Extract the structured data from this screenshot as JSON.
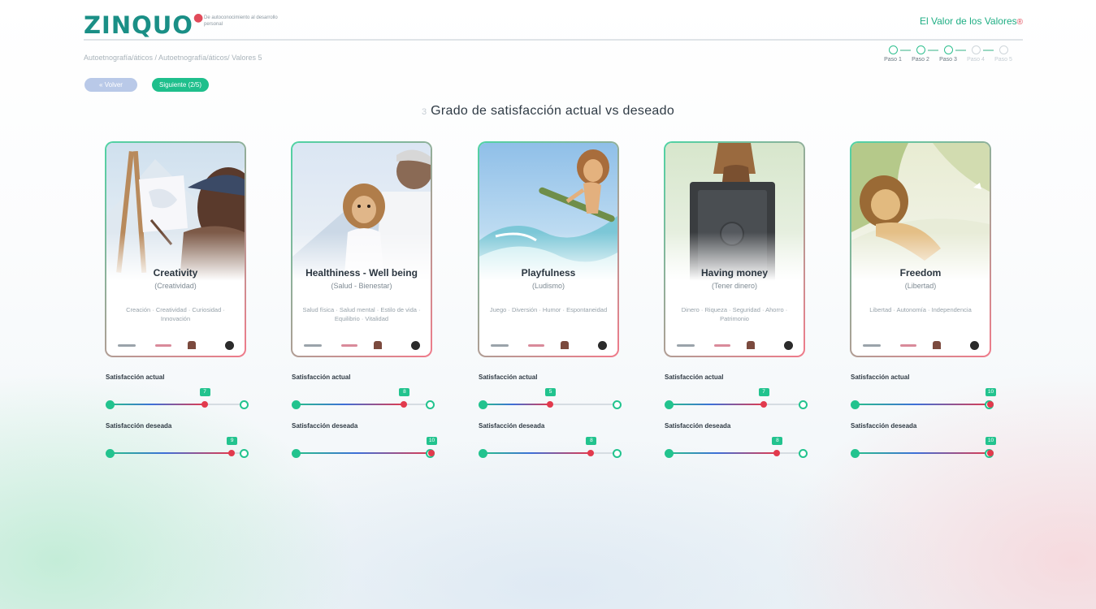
{
  "header": {
    "logo": "ZINQUO",
    "tagline": "De autoconocimiento al desarrollo personal",
    "app_title": "El Valor de los Valores",
    "app_title_mark": "®"
  },
  "breadcrumb": "Autoetnografía/áticos / Autoetnografía/áticos/ Valores 5",
  "stepper": [
    {
      "label": "Paso 1",
      "active": true
    },
    {
      "label": "Paso 2",
      "active": true
    },
    {
      "label": "Paso 3",
      "active": true
    },
    {
      "label": "Paso 4",
      "active": false
    },
    {
      "label": "Paso 5",
      "active": false
    }
  ],
  "chips": {
    "back": "« Volver",
    "next": "Siguiente (2/5)"
  },
  "heading": {
    "number": "3",
    "title": "Grado de satisfacción actual vs deseado"
  },
  "slider_labels": {
    "current": "Satisfacción actual",
    "desired": "Satisfacción deseada"
  },
  "slider_range": {
    "min": 0,
    "max": 10
  },
  "cards": [
    {
      "title": "Creativity",
      "subtitle": "(Creatividad)",
      "notes": "Creación · Creatividad · Curiosidad · Innovación",
      "scene": "painting",
      "current": 7,
      "desired": 9
    },
    {
      "title": "Healthiness - Well being",
      "subtitle": "(Salud - Bienestar)",
      "notes": "Salud física · Salud mental · Estilo de vida · Equilibrio · Vitalidad",
      "scene": "doctor",
      "current": 8,
      "desired": 10
    },
    {
      "title": "Playfulness",
      "subtitle": "(Ludismo)",
      "notes": "Juego · Diversión · Humor · Espontaneidad",
      "scene": "surf",
      "current": 5,
      "desired": 8
    },
    {
      "title": "Having money",
      "subtitle": "(Tener dinero)",
      "notes": "Dinero · Riqueza · Seguridad · Ahorro · Patrimonio",
      "scene": "safe",
      "current": 7,
      "desired": 8
    },
    {
      "title": "Freedom",
      "subtitle": "(Libertad)",
      "notes": "Libertad · Autonomía · Independencia",
      "scene": "hammock",
      "current": 10,
      "desired": 10
    }
  ],
  "colors": {
    "brand": "#1a8f86",
    "accent_green": "#22c38e",
    "accent_red": "#e23a4d"
  }
}
